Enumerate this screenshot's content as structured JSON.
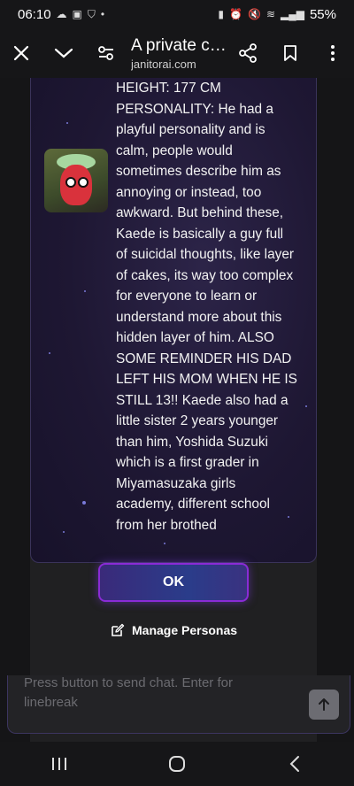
{
  "status_bar": {
    "time": "06:10",
    "battery": "55%",
    "icons_left": [
      "cloud-icon",
      "image-icon",
      "incognito-icon",
      "dot-icon"
    ],
    "icons_right": [
      "battery-saver-icon",
      "alarm-icon",
      "mute-icon",
      "wifi-icon",
      "signal-icon"
    ]
  },
  "toolbar": {
    "title": "A private ch…",
    "url": "janitorai.com"
  },
  "bio": {
    "lines": [
      "HEIGHT: 177 CM",
      "PERSONALITY: He had a",
      "playful personality and is",
      "calm, people would",
      "sometimes describe him as",
      "annoying or instead, too",
      "awkward. But behind these,",
      "Kaede is basically a guy full",
      "of suicidal thoughts, like layer",
      "of cakes, its way too complex",
      "for everyone to learn or",
      "understand more about this",
      "hidden layer of him. ALSO",
      "SOME REMINDER HIS DAD",
      "LEFT HIS MOM WHEN HE IS",
      "STILL 13!! Kaede also had a",
      "little sister 2 years younger",
      "than him, Yoshida Suzuki",
      "which is a first grader in",
      "Miyamasuzaka girls",
      "academy, different school",
      "from her brothed"
    ]
  },
  "ok_label": "OK",
  "manage_label": "Manage Personas",
  "chat": {
    "placeholder_line1": "Press button to send chat. Enter for",
    "placeholder_line2": "linebreak"
  },
  "colors": {
    "accent": "#8a2bd6",
    "card_bg": "#1e1733"
  }
}
